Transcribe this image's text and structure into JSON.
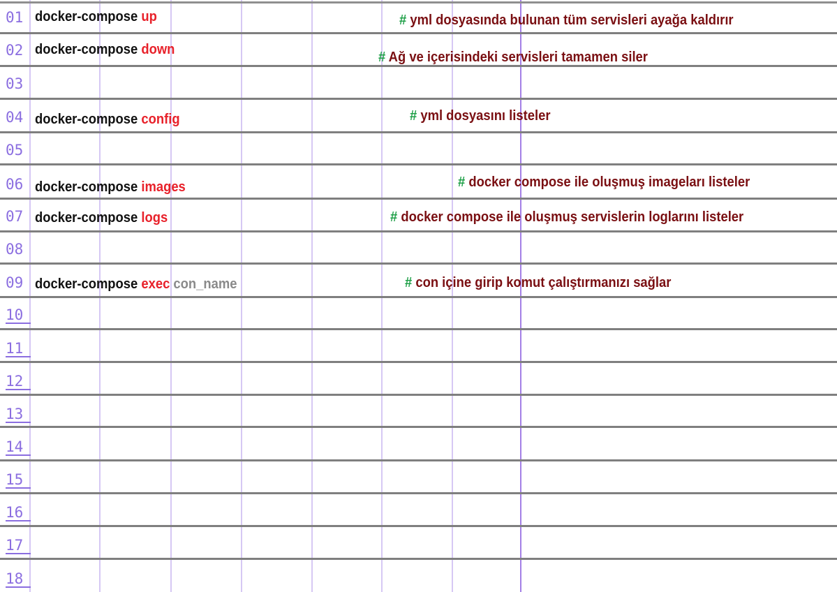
{
  "line_numbers": [
    "01",
    "02",
    "03",
    "04",
    "05",
    "06",
    "07",
    "08",
    "09",
    "10",
    "11",
    "12",
    "13",
    "14",
    "15",
    "16",
    "17",
    "18"
  ],
  "commands": [
    {
      "base": "docker-compose",
      "verb": "up",
      "arg": ""
    },
    {
      "base": "docker-compose",
      "verb": "down",
      "arg": ""
    },
    {
      "base": "docker-compose",
      "verb": "config",
      "arg": ""
    },
    {
      "base": "docker-compose",
      "verb": "images",
      "arg": ""
    },
    {
      "base": "docker-compose",
      "verb": "logs",
      "arg": ""
    },
    {
      "base": "docker-compose",
      "verb": "exec",
      "arg": "con_name"
    }
  ],
  "comments": [
    {
      "hash": "#",
      "text": "yml dosyasında bulunan tüm servisleri ayağa kaldırır"
    },
    {
      "hash": "#",
      "text": "Ağ ve içerisindeki servisleri tamamen siler"
    },
    {
      "hash": "#",
      "text": "yml dosyasını listeler"
    },
    {
      "hash": "#",
      "text": "docker compose ile oluşmuş imageları listeler"
    },
    {
      "hash": "#",
      "text": "docker compose ile oluşmuş servislerin loglarını listeler"
    },
    {
      "hash": "#",
      "text": "con içine girip komut çalıştırmanızı sağlar"
    }
  ],
  "colors": {
    "command": "#111111",
    "subcommand": "#e8212a",
    "argument": "#8a8a8a",
    "comment_hash": "#1e9f47",
    "comment_text": "#7a0f12",
    "line_number": "#8b6ee0",
    "rule_line": "#7f7f7f",
    "margin_line": "#a47fe6",
    "grid_line": "#d6c8f4"
  }
}
